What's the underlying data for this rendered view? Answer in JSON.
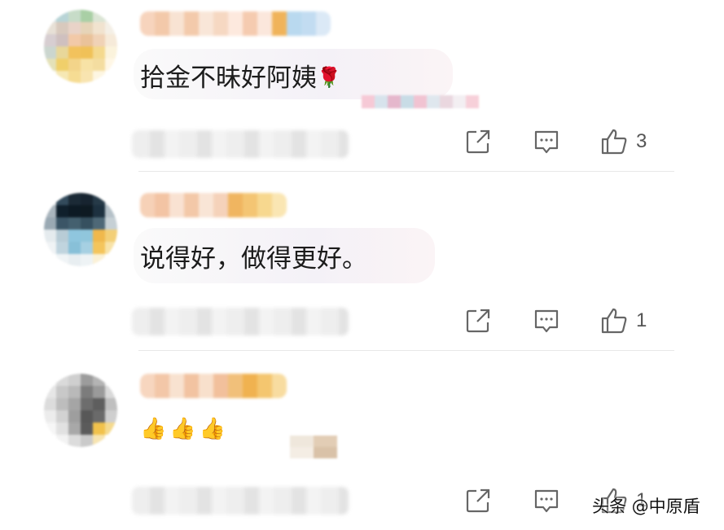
{
  "comments": [
    {
      "text": "拾金不昧好阿姨",
      "emoji": "🌹",
      "likes": "3",
      "avatar_colors": [
        "#d9e6e9",
        "#b8d4d6",
        "#c7dcc8",
        "#a9cfa5",
        "#dbe5d5",
        "#e9efe7",
        "#e7e0d6",
        "#d8c9bd",
        "#e9d3c8",
        "#e6d4b8",
        "#f1e3cf",
        "#f4efe6",
        "#d7ced1",
        "#cfc0bf",
        "#f2c9a8",
        "#eac29a",
        "#f0d2b6",
        "#f6ead9",
        "#cbd6cf",
        "#e8d79a",
        "#f2c25c",
        "#f0c158",
        "#f4d98e",
        "#fbf3dc",
        "#e4e1b8",
        "#f0cf6a",
        "#f3d48a",
        "#f7e2a6",
        "#f4dda0",
        "#fff7e6",
        "#fbfaf5",
        "#f6e8b4",
        "#f6dc93",
        "#f8e4b0",
        "#fdf6e2",
        "#ffffff"
      ],
      "name_colors": [
        "#f7d4bd",
        "#f3c9aa",
        "#f8e3d3",
        "#f3caab",
        "#f9e6d8",
        "#f6d8c2",
        "#fde9de",
        "#f5cbb0",
        "#fbe7dc",
        "#f0b35a",
        "#b9d9ef",
        "#c2dcf1",
        "#dbe9f6"
      ]
    },
    {
      "text": "说得好，做得更好。",
      "likes": "1",
      "avatar_colors": [
        "#dfe2e4",
        "#334b5c",
        "#1b2a36",
        "#172430",
        "#263a48",
        "#d7dde1",
        "#a9b5bd",
        "#10202c",
        "#0d1a24",
        "#0e1a22",
        "#1d3140",
        "#b5c1c8",
        "#9aa9b3",
        "#3b5566",
        "#44606f",
        "#36505f",
        "#4e6877",
        "#c6d0d5",
        "#e5ebee",
        "#b8ccd6",
        "#8fc6de",
        "#90c6dc",
        "#f0b84c",
        "#f3cf77",
        "#f0f3f5",
        "#c0d4de",
        "#88c0d8",
        "#a6d0e2",
        "#f4c55c",
        "#f8e3a8",
        "#ffffff",
        "#f0f4f6",
        "#e8eef1",
        "#eef3f5",
        "#fbf1d6",
        "#ffffff"
      ],
      "name_colors": [
        "#f6d1b7",
        "#f3c4a4",
        "#f9e2d2",
        "#f3c8a8",
        "#f9e5d6",
        "#f5d2ba",
        "#f0b560",
        "#f4c573",
        "#f7d88f",
        "#fae6b3"
      ]
    },
    {
      "thumbs": "👍👍👍",
      "likes": "1",
      "avatar_colors": [
        "#f2f2f2",
        "#dadada",
        "#cfcfcf",
        "#9c9c9c",
        "#b4b4b4",
        "#f4f4f4",
        "#e6e6e6",
        "#c8c8c8",
        "#b9b9b9",
        "#7c7c7c",
        "#9a9a9a",
        "#d9d9d9",
        "#dcdcdc",
        "#bdbdbd",
        "#a5a5a5",
        "#6d6d6d",
        "#5e5e5e",
        "#bfbfbf",
        "#ececec",
        "#d2d2d2",
        "#9e9e9e",
        "#585858",
        "#6a6a6a",
        "#cfcfcf",
        "#f6f6f6",
        "#e1e1e1",
        "#a8a8a8",
        "#5b5b5b",
        "#f1c24c",
        "#f5da8e",
        "#ffffff",
        "#f3f3f3",
        "#dcdcdc",
        "#cacaca",
        "#f7e4b0",
        "#ffffff"
      ],
      "name_colors": [
        "#f7d6bf",
        "#f3c7a8",
        "#f8e2d0",
        "#f2c3a1",
        "#f8e0cc",
        "#f2c09c",
        "#f1c07a",
        "#f0b250",
        "#f4c66f",
        "#f8dca0"
      ]
    }
  ],
  "watermark": "头条 @中原盾",
  "icons": {
    "share": "share-icon",
    "reply": "reply-icon",
    "like": "thumbs-up-icon"
  }
}
